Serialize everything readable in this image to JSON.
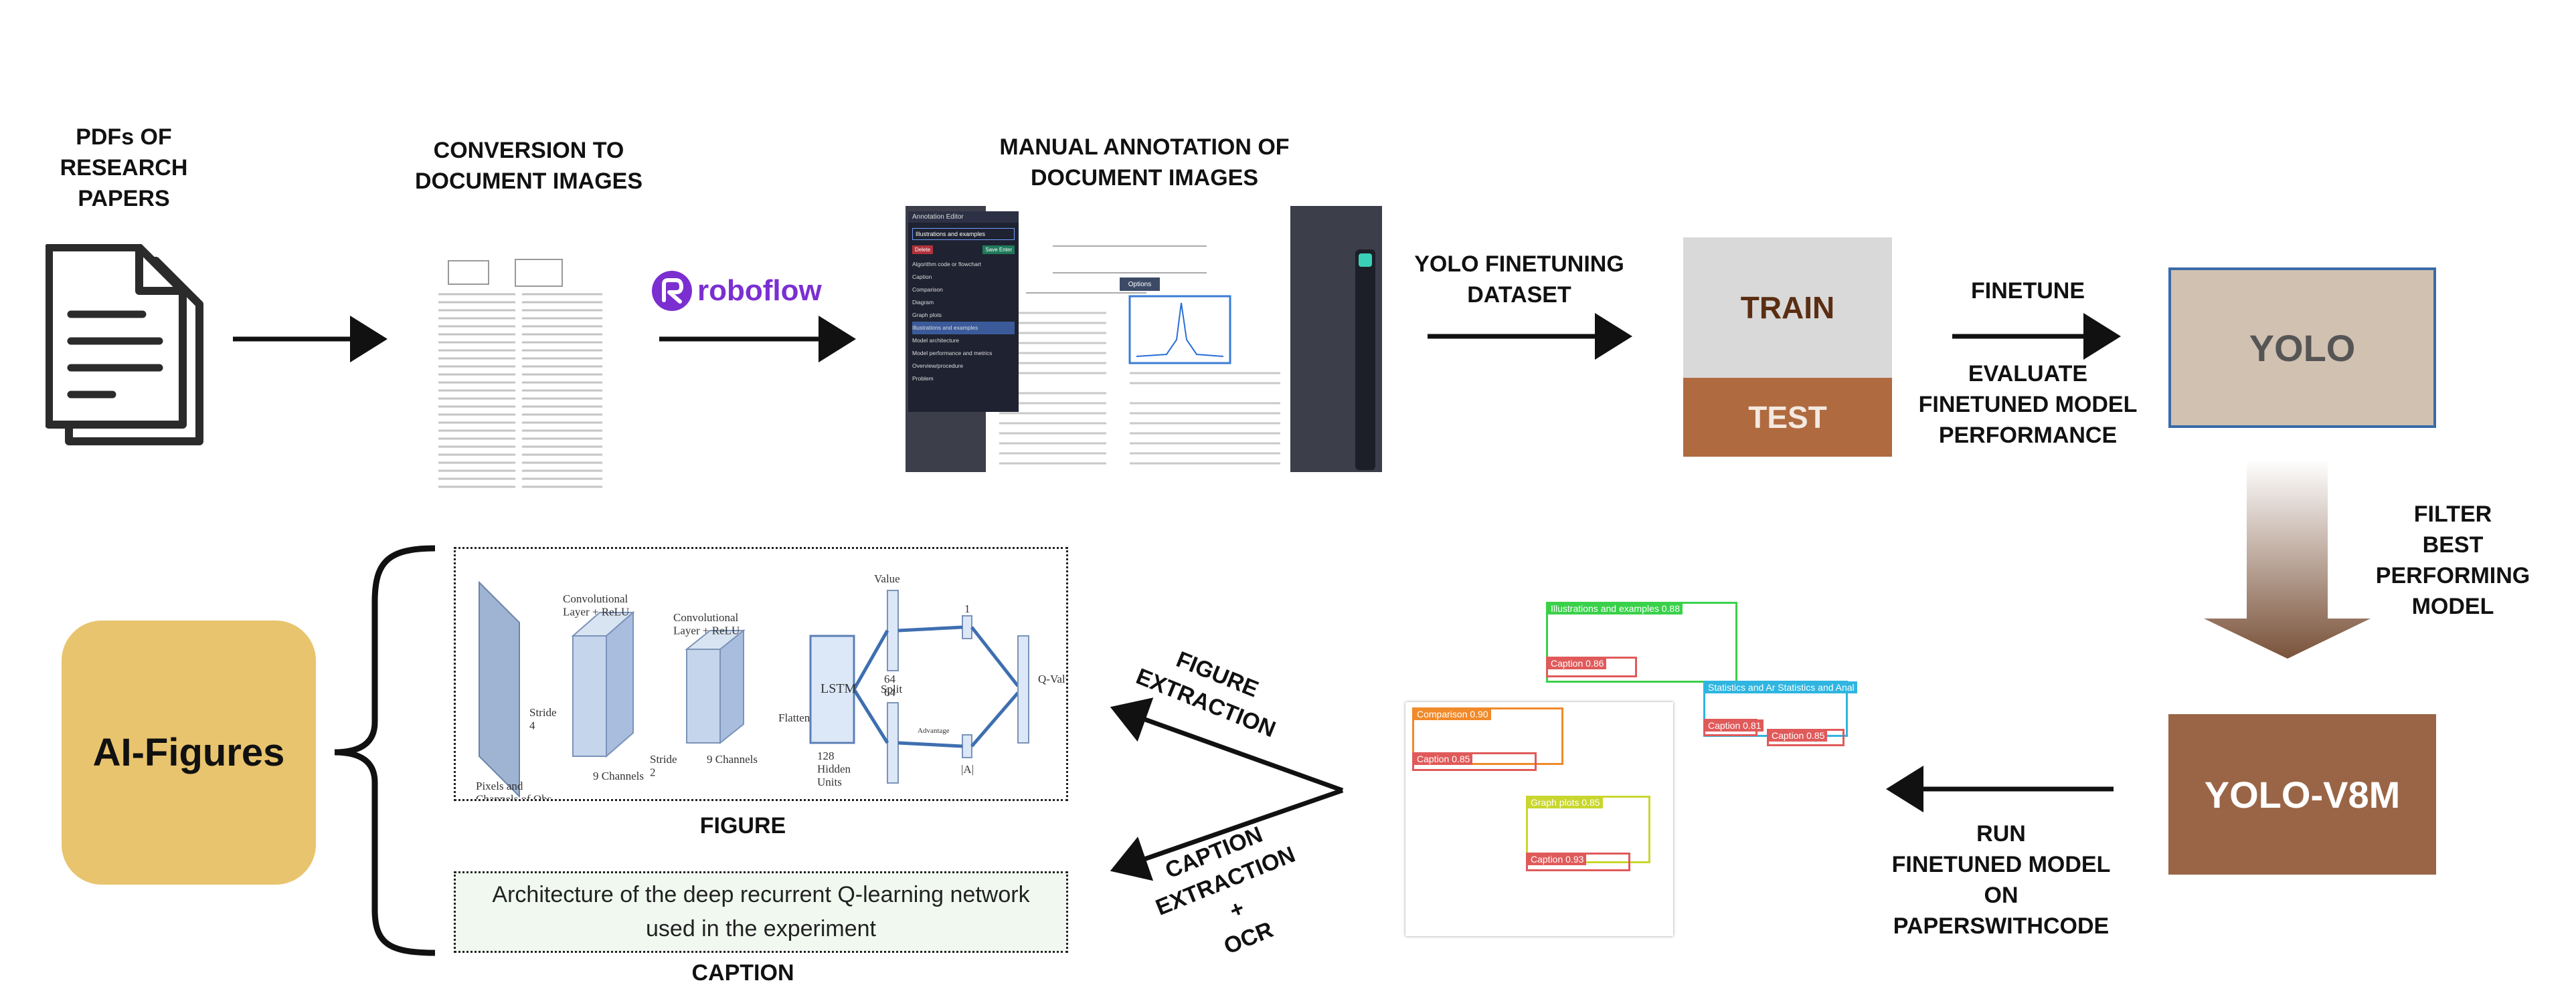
{
  "steps": {
    "pdfs": "PDFs OF\nRESEARCH\nPAPERS",
    "conversion": "CONVERSION TO\nDOCUMENT IMAGES",
    "annotation": "MANUAL ANNOTATION OF\nDOCUMENT IMAGES",
    "dataset": "YOLO FINETUNING\nDATASET",
    "finetune": "FINETUNE",
    "evaluate": "EVALUATE\nFINETUNED MODEL\nPERFORMANCE",
    "filter": "FILTER\nBEST\nPERFORMING\nMODEL",
    "run": "RUN\nFINETUNED MODEL\nON\nPAPERSWITHCODE",
    "figure_extraction": "FIGURE\nEXTRACTION",
    "caption_extraction": "CAPTION\nEXTRACTION\n+\nOCR"
  },
  "roboflow": "roboflow",
  "split": {
    "train": "TRAIN",
    "test": "TEST"
  },
  "models": {
    "yolo": "YOLO",
    "yolov8m": "YOLO-V8M"
  },
  "output": {
    "name": "AI-Figures",
    "figure_label": "FIGURE",
    "caption_label": "CAPTION",
    "caption_text": "Architecture of the deep recurrent Q-learning network used in the experiment"
  },
  "annotation_editor": {
    "title": "Annotation Editor",
    "selected": "Illustrations and examples",
    "delete": "Delete",
    "save": "Save Enter",
    "classes": [
      "Algorithm code or flowchart",
      "Caption",
      "Comparison",
      "Diagram",
      "Graph plots",
      "Illustrations and examples",
      "Model architecture",
      "Model performance and metrics",
      "Overview/procedure",
      "Problem"
    ],
    "options": "Options"
  },
  "detections": [
    {
      "label": "Illustrations and examples 0.88",
      "color": "#39d14a"
    },
    {
      "label": "Caption 0.86",
      "color": "#e05a5a"
    },
    {
      "label": "Statistics and Ar Statistics and Anal",
      "color": "#2fb5e0"
    },
    {
      "label": "Caption 0.81",
      "color": "#e05a5a"
    },
    {
      "label": "Caption 0.85",
      "color": "#e05a5a"
    },
    {
      "label": "Comparison 0.90",
      "color": "#f08a2a"
    },
    {
      "label": "Caption 0.85",
      "color": "#e05a5a"
    },
    {
      "label": "Graph plots 0.85",
      "color": "#c9d62e"
    },
    {
      "label": "Caption 0.93",
      "color": "#e05a5a"
    }
  ],
  "figure_diagram": {
    "conv1": "Convolutional\nLayer + ReLU",
    "conv2": "Convolutional\nLayer + ReLU",
    "value": "Value",
    "qvalues": "Q-Values",
    "pixels": "Pixels and\nChannels of Obs.",
    "strides4": "Stride\n4",
    "channels9a": "9 Channels",
    "strides2": "Stride\n2",
    "channels9b": "9 Channels",
    "lstm": "LSTM",
    "flatten": "Flatten",
    "hidden": "128\nHidden\nUnits",
    "split": "Split",
    "n64a": "64",
    "n64b": "64",
    "advantage": "Advantage",
    "a": "|A|",
    "n1": "1"
  },
  "colors": {
    "arrow": "#111111",
    "train_bg": "#d9d9d9",
    "test_bg": "#b06a40",
    "yolo_bg": "#d1c1b1",
    "yolo_border": "#3a6aa8",
    "yolov8_bg": "#9a6546",
    "ai_bg": "#e8c46e",
    "roboflow": "#7b2fd1"
  }
}
